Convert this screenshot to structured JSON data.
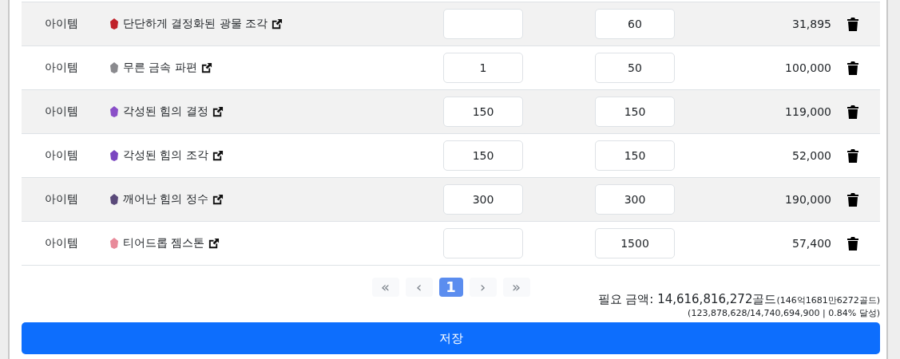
{
  "rows": [
    {
      "type": "아이템",
      "name": "단단하게 결정화된 광물 조각",
      "color": "#c0222a",
      "qty": "",
      "target": "60",
      "price": "31,895"
    },
    {
      "type": "아이템",
      "name": "무른 금속 파편",
      "color": "#8a8a8e",
      "qty": "1",
      "target": "50",
      "price": "100,000"
    },
    {
      "type": "아이템",
      "name": "각성된 힘의 결정",
      "color": "#8a4fc8",
      "qty": "150",
      "target": "150",
      "price": "119,000"
    },
    {
      "type": "아이템",
      "name": "각성된 힘의 조각",
      "color": "#7a45c0",
      "qty": "150",
      "target": "150",
      "price": "52,000"
    },
    {
      "type": "아이템",
      "name": "깨어난 힘의 정수",
      "color": "#5a4a7a",
      "qty": "300",
      "target": "300",
      "price": "190,000"
    },
    {
      "type": "아이템",
      "name": "티어드롭 젬스톤",
      "color": "#e88a9a",
      "qty": "",
      "target": "1500",
      "price": "57,400"
    }
  ],
  "pagination": [
    {
      "label": "«",
      "selected": false,
      "disabled": true
    },
    {
      "label": "‹",
      "selected": false,
      "disabled": true
    },
    {
      "label": "1",
      "selected": true,
      "disabled": false
    },
    {
      "label": "›",
      "selected": false,
      "disabled": true
    },
    {
      "label": "»",
      "selected": false,
      "disabled": true
    }
  ],
  "total": {
    "label": "필요 금액: 14,616,816,272골드",
    "sub": "(146억1681만6272골드)",
    "progress": "(123,878,628/14,740,694,900 | 0.84% 달성)"
  },
  "save_button": "저장"
}
